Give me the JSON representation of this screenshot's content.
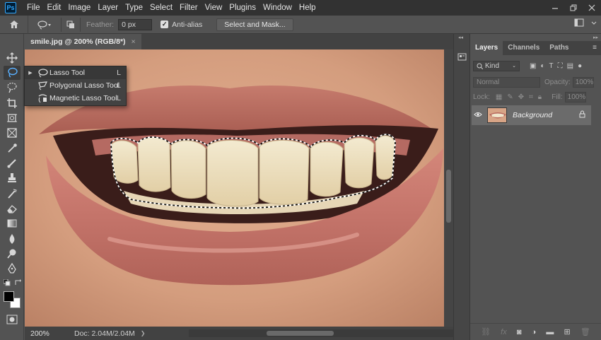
{
  "app": {
    "logo": "Ps"
  },
  "menu": [
    "File",
    "Edit",
    "Image",
    "Layer",
    "Type",
    "Select",
    "Filter",
    "View",
    "Plugins",
    "Window",
    "Help"
  ],
  "options": {
    "feather_label": "Feather:",
    "feather_value": "0 px",
    "antialias_label": "Anti-alias",
    "antialias_checked": true,
    "select_mask_label": "Select and Mask..."
  },
  "document": {
    "tab_title": "smile.jpg @ 200% (RGB/8*)",
    "tab_close": "×",
    "zoom": "200%",
    "doc_info": "Doc: 2.04M/2.04M"
  },
  "flyout": {
    "items": [
      {
        "label": "Lasso Tool",
        "key": "L",
        "selected": true
      },
      {
        "label": "Polygonal Lasso Tool",
        "key": "L",
        "selected": false
      },
      {
        "label": "Magnetic Lasso Tool",
        "key": "L",
        "selected": false
      }
    ]
  },
  "panel": {
    "tabs": [
      "Layers",
      "Channels",
      "Paths"
    ],
    "active_tab": "Layers",
    "kind_label": "Kind",
    "blend_mode": "Normal",
    "opacity_label": "Opacity:",
    "opacity_value": "100%",
    "lock_label": "Lock:",
    "fill_label": "Fill:",
    "fill_value": "100%",
    "layers": [
      {
        "name": "Background",
        "visible": true,
        "locked": true
      }
    ]
  },
  "colors": {
    "foreground": "#000000",
    "background": "#ffffff",
    "accent": "#31a8ff"
  }
}
